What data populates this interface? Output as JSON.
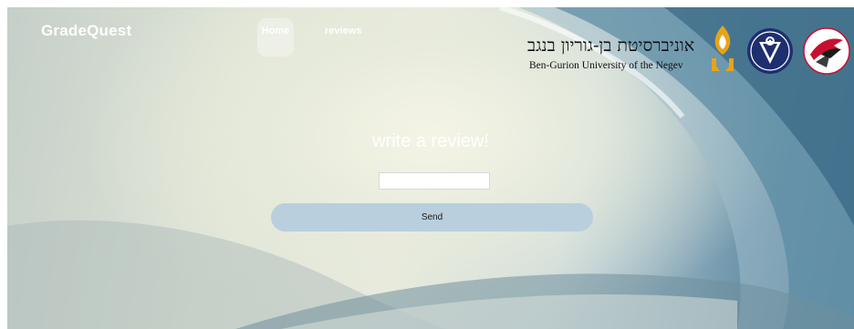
{
  "brand": {
    "name": "GradeQuest"
  },
  "nav": {
    "home_label": "Home",
    "reviews_label": "reviews"
  },
  "university": {
    "hebrew_name": "אוניברסיטת בן-גוריון בנגב",
    "english_name": "Ben-Gurion University of the Negev"
  },
  "form": {
    "heading": "write a review!",
    "input_value": "",
    "input_placeholder": "",
    "send_label": "Send"
  },
  "colors": {
    "button_bg": "#b9cfdd",
    "logo_gold": "#e8a317",
    "logo_navy": "#1d2f6f",
    "logo_red": "#c8102e"
  },
  "icons": [
    "flame-logo-icon",
    "shield-logo-icon",
    "bird-logo-icon"
  ]
}
